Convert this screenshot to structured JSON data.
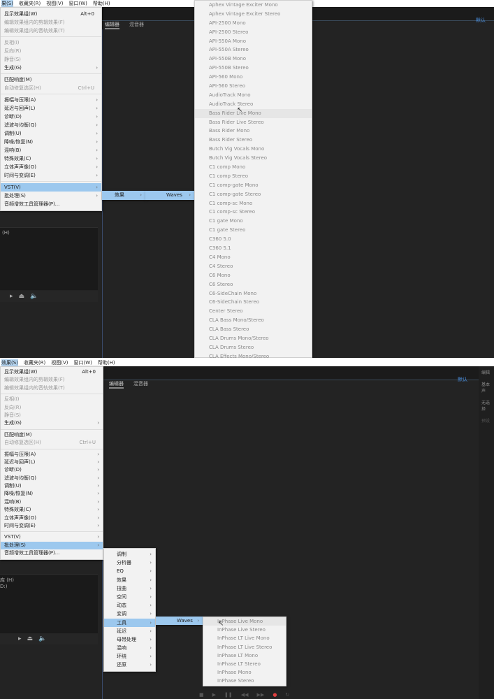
{
  "top": {
    "menubar": [
      "果(S)",
      "收藏夹(R)",
      "视图(V)",
      "窗口(W)",
      "帮助(H)"
    ],
    "workspace": "默认",
    "tabs": [
      "编辑器",
      "混音器"
    ],
    "left_label": "(H)",
    "menu": [
      {
        "label": "显示效果组(W)",
        "sc": "Alt+0"
      },
      {
        "label": "编辑效果组内的剪辑效果(F)",
        "dis": true
      },
      {
        "label": "编辑效果组内的音轨效果(T)",
        "dis": true
      },
      {
        "sep": true
      },
      {
        "label": "反相(I)",
        "dis": true
      },
      {
        "label": "反向(R)",
        "dis": true
      },
      {
        "label": "静音(S)",
        "dis": true
      },
      {
        "label": "生成(G)",
        "ar": true
      },
      {
        "sep": true
      },
      {
        "label": "匹配响度(M)"
      },
      {
        "label": "自动修复选区(H)",
        "sc": "Ctrl+U",
        "dis": true
      },
      {
        "sep": true
      },
      {
        "label": "振幅与压限(A)",
        "ar": true
      },
      {
        "label": "延迟与回声(L)",
        "ar": true
      },
      {
        "label": "诊断(D)",
        "ar": true
      },
      {
        "label": "滤波与均衡(Q)",
        "ar": true
      },
      {
        "label": "调制(U)",
        "ar": true
      },
      {
        "label": "降噪/恢复(N)",
        "ar": true
      },
      {
        "label": "混响(B)",
        "ar": true
      },
      {
        "label": "特殊效果(C)",
        "ar": true
      },
      {
        "label": "立体声声像(O)",
        "ar": true
      },
      {
        "label": "时间与变调(E)",
        "ar": true
      },
      {
        "sep": true
      },
      {
        "label": "VST(V)",
        "ar": true,
        "hl": true
      },
      {
        "label": "批处理(S)",
        "ar": true
      },
      {
        "label": "音频增效工具管理器(P)..."
      }
    ],
    "sub1": [
      {
        "label": "效果",
        "ar": true,
        "hl": true
      }
    ],
    "sub2": [
      {
        "label": "Waves",
        "ar": true,
        "hl": true
      }
    ],
    "plugins": [
      "Aphex Vintage Exciter Mono",
      "Aphex Vintage Exciter Stereo",
      "API-2500 Mono",
      "API-2500 Stereo",
      "API-550A Mono",
      "API-550A Stereo",
      "API-550B Mono",
      "API-550B Stereo",
      "API-560 Mono",
      "API-560 Stereo",
      "AudioTrack Mono",
      "AudioTrack Stereo",
      "Bass Rider Live Mono",
      "Bass Rider Live Stereo",
      "Bass Rider Mono",
      "Bass Rider Stereo",
      "Butch Vig Vocals Mono",
      "Butch Vig Vocals Stereo",
      "C1 comp Mono",
      "C1 comp Stereo",
      "C1 comp-gate Mono",
      "C1 comp-gate Stereo",
      "C1 comp-sc Mono",
      "C1 comp-sc Stereo",
      "C1 gate Mono",
      "C1 gate Stereo",
      "C360 5.0",
      "C360 5.1",
      "C4 Mono",
      "C4 Stereo",
      "C6 Mono",
      "C6 Stereo",
      "C6-SideChain Mono",
      "C6-SideChain Stereo",
      "Center Stereo",
      "CLA Bass Mono/Stereo",
      "CLA Bass Stereo",
      "CLA Drums Mono/Stereo",
      "CLA Drums Stereo",
      "CLA Effects Mono/Stereo"
    ]
  },
  "bottom": {
    "menubar": [
      "效果(S)",
      "收藏夹(R)",
      "视图(V)",
      "窗口(W)",
      "帮助(H)"
    ],
    "workspace": "默认",
    "tabs": [
      "编辑器",
      "混音器"
    ],
    "right_panel": [
      "编辑",
      "基本声",
      "无选择",
      "预设"
    ],
    "left_labels": [
      "库 (H)",
      "D:)"
    ],
    "menu": [
      {
        "label": "显示效果组(W)",
        "sc": "Alt+0"
      },
      {
        "label": "编辑效果组内的剪辑效果(F)",
        "dis": true
      },
      {
        "label": "编辑效果组内的音轨效果(T)",
        "dis": true
      },
      {
        "sep": true
      },
      {
        "label": "反相(I)",
        "dis": true
      },
      {
        "label": "反向(R)",
        "dis": true
      },
      {
        "label": "静音(S)",
        "dis": true
      },
      {
        "label": "生成(G)",
        "ar": true
      },
      {
        "sep": true
      },
      {
        "label": "匹配响度(M)"
      },
      {
        "label": "自动修复选区(H)",
        "sc": "Ctrl+U",
        "dis": true
      },
      {
        "sep": true
      },
      {
        "label": "振幅与压限(A)",
        "ar": true
      },
      {
        "label": "延迟与回声(L)",
        "ar": true
      },
      {
        "label": "诊断(D)",
        "ar": true
      },
      {
        "label": "滤波与均衡(Q)",
        "ar": true
      },
      {
        "label": "调制(U)",
        "ar": true
      },
      {
        "label": "降噪/恢复(N)",
        "ar": true
      },
      {
        "label": "混响(B)",
        "ar": true
      },
      {
        "label": "特殊效果(C)",
        "ar": true
      },
      {
        "label": "立体声声像(O)",
        "ar": true
      },
      {
        "label": "时间与变调(E)",
        "ar": true
      },
      {
        "sep": true
      },
      {
        "label": "VST(V)",
        "ar": true
      },
      {
        "label": "批处理(S)",
        "ar": true,
        "hl": true
      },
      {
        "label": "音频增效工具管理器(P)..."
      }
    ],
    "sub1": [
      {
        "label": "调制",
        "ar": true
      },
      {
        "label": "分析器",
        "ar": true
      },
      {
        "label": "EQ",
        "ar": true
      },
      {
        "label": "效果",
        "ar": true
      },
      {
        "label": "扭曲",
        "ar": true
      },
      {
        "label": "空间",
        "ar": true
      },
      {
        "label": "动态",
        "ar": true
      },
      {
        "label": "变调",
        "ar": true
      },
      {
        "label": "工具",
        "ar": true,
        "hl": true
      },
      {
        "label": "延迟",
        "ar": true
      },
      {
        "label": "母带处理",
        "ar": true
      },
      {
        "label": "混响",
        "ar": true
      },
      {
        "label": "环绕",
        "ar": true
      },
      {
        "label": "还原",
        "ar": true
      }
    ],
    "sub2": [
      {
        "label": "Waves",
        "ar": true,
        "hl": true
      }
    ],
    "plugins": [
      "InPhase Live Mono",
      "InPhase Live Stereo",
      "InPhase LT Live Mono",
      "InPhase LT Live Stereo",
      "InPhase LT Mono",
      "InPhase LT Stereo",
      "InPhase Mono",
      "InPhase Stereo"
    ]
  }
}
